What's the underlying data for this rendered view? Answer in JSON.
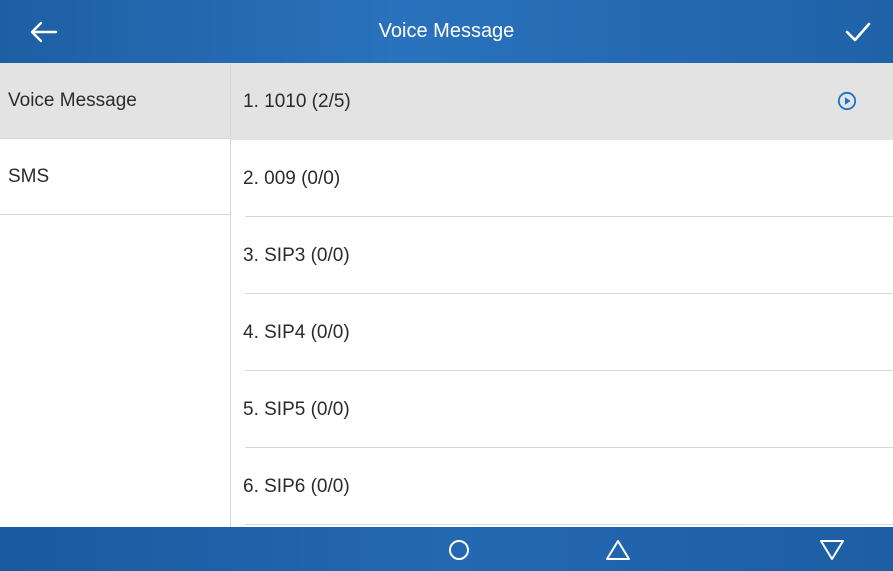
{
  "header": {
    "title": "Voice Message",
    "back_icon": "back-arrow-icon",
    "confirm_icon": "checkmark-icon"
  },
  "sidebar": {
    "items": [
      {
        "label": "Voice Message",
        "selected": true
      },
      {
        "label": "SMS",
        "selected": false
      }
    ]
  },
  "accounts": [
    {
      "label": "1. 1010 (2/5)",
      "selected": true,
      "icon": "play-icon"
    },
    {
      "label": "2. 009 (0/0)",
      "selected": false
    },
    {
      "label": "3. SIP3 (0/0)",
      "selected": false
    },
    {
      "label": "4. SIP4 (0/0)",
      "selected": false
    },
    {
      "label": "5. SIP5 (0/0)",
      "selected": false
    },
    {
      "label": "6. SIP6 (0/0)",
      "selected": false
    }
  ],
  "softkeys": [
    "circle-icon",
    "triangle-up-icon",
    "triangle-down-icon"
  ],
  "colors": {
    "header_bg": "#2a72bd",
    "footer_bg": "#2468b2",
    "selected_bg": "#e3e3e3",
    "accent": "#1a73c9"
  }
}
